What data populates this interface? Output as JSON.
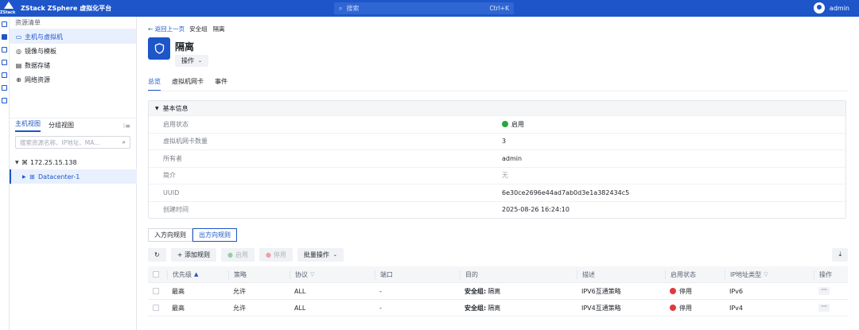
{
  "topbar": {
    "brand_small": "ZStack",
    "title": "ZStack ZSphere 虚拟化平台",
    "search_placeholder": "搜索",
    "search_shortcut": "Ctrl+K",
    "user": "admin"
  },
  "resources": {
    "title": "资源清单",
    "items": [
      {
        "label": "主机与虚拟机",
        "icon": "monitor-icon"
      },
      {
        "label": "镜像与模板",
        "icon": "disc-icon"
      },
      {
        "label": "数据存储",
        "icon": "storage-icon"
      },
      {
        "label": "网络资源",
        "icon": "globe-icon"
      }
    ],
    "tree_tabs": [
      "主机视图",
      "分组视图"
    ],
    "tree_search_placeholder": "搜索资源名称、IP地址、MA...",
    "tree_root": "172.25.15.138",
    "tree_child": "Datacenter-1"
  },
  "breadcrumb": {
    "back": "← 返回上一页",
    "items": [
      "安全组",
      "隔离"
    ]
  },
  "page": {
    "title": "隔离",
    "ops_button": "操作",
    "tabs": [
      "总览",
      "虚拟机网卡",
      "事件"
    ]
  },
  "basic_info": {
    "title": "基本信息",
    "rows": [
      {
        "key": "启用状态",
        "value": "启用"
      },
      {
        "key": "虚拟机网卡数量",
        "value": "3"
      },
      {
        "key": "所有者",
        "value": "admin"
      },
      {
        "key": "简介",
        "value": "无"
      },
      {
        "key": "UUID",
        "value": "6e30ce2696e44ad7ab0d3e1a382434c5"
      },
      {
        "key": "创建时间",
        "value": "2025-08-26 16:24:10"
      }
    ]
  },
  "rules": {
    "tabs": [
      "入方向规则",
      "出方向规则"
    ],
    "toolbar": {
      "add": "+ 添加规则",
      "enable": "启用",
      "disable": "停用",
      "batch": "批量操作"
    },
    "columns": [
      "优先级",
      "策略",
      "协议",
      "端口",
      "目的",
      "描述",
      "启用状态",
      "IP地址类型",
      "操作"
    ],
    "rows": [
      {
        "priority": "最高",
        "policy": "允许",
        "protocol": "ALL",
        "port": "-",
        "dest_label": "安全组:",
        "dest_value": "隔离",
        "desc": "IPV6互通策略",
        "status": "停用",
        "ip_type": "IPv6"
      },
      {
        "priority": "最高",
        "policy": "允许",
        "protocol": "ALL",
        "port": "-",
        "dest_label": "安全组:",
        "dest_value": "隔离",
        "desc": "IPV4互通策略",
        "status": "停用",
        "ip_type": "IPv4"
      }
    ]
  },
  "colors": {
    "brand": "#1e56c9",
    "enabled": "#26a641",
    "disabled": "#e0393e"
  }
}
